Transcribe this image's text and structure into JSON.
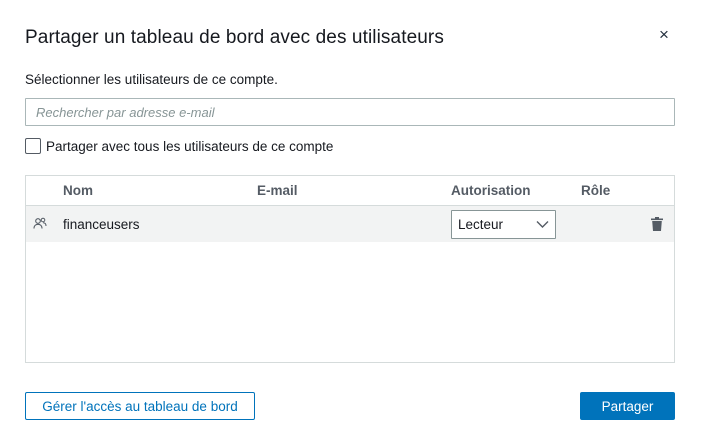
{
  "dialog": {
    "title": "Partager un tableau de bord avec des utilisateurs",
    "close_glyph": "×",
    "instructions": "Sélectionner les utilisateurs de ce compte.",
    "search": {
      "placeholder": "Rechercher par adresse e-mail",
      "value": ""
    },
    "share_all": {
      "label": "Partager avec tous les utilisateurs de ce compte",
      "checked": false
    }
  },
  "table": {
    "columns": [
      {
        "label": "Nom"
      },
      {
        "label": "E-mail"
      },
      {
        "label": "Autorisation"
      },
      {
        "label": "Rôle"
      }
    ],
    "rows": [
      {
        "icon": "user-group-icon",
        "name": "financeusers",
        "email": "",
        "permission": "Lecteur",
        "role": ""
      }
    ]
  },
  "footer": {
    "manage_label": "Gérer l'accès au tableau de bord",
    "share_label": "Partager"
  },
  "colors": {
    "primary": "#0073bb",
    "border": "#d5dbdb",
    "row_bg": "#f2f3f3",
    "text": "#16191f",
    "header_text": "#545b64"
  }
}
